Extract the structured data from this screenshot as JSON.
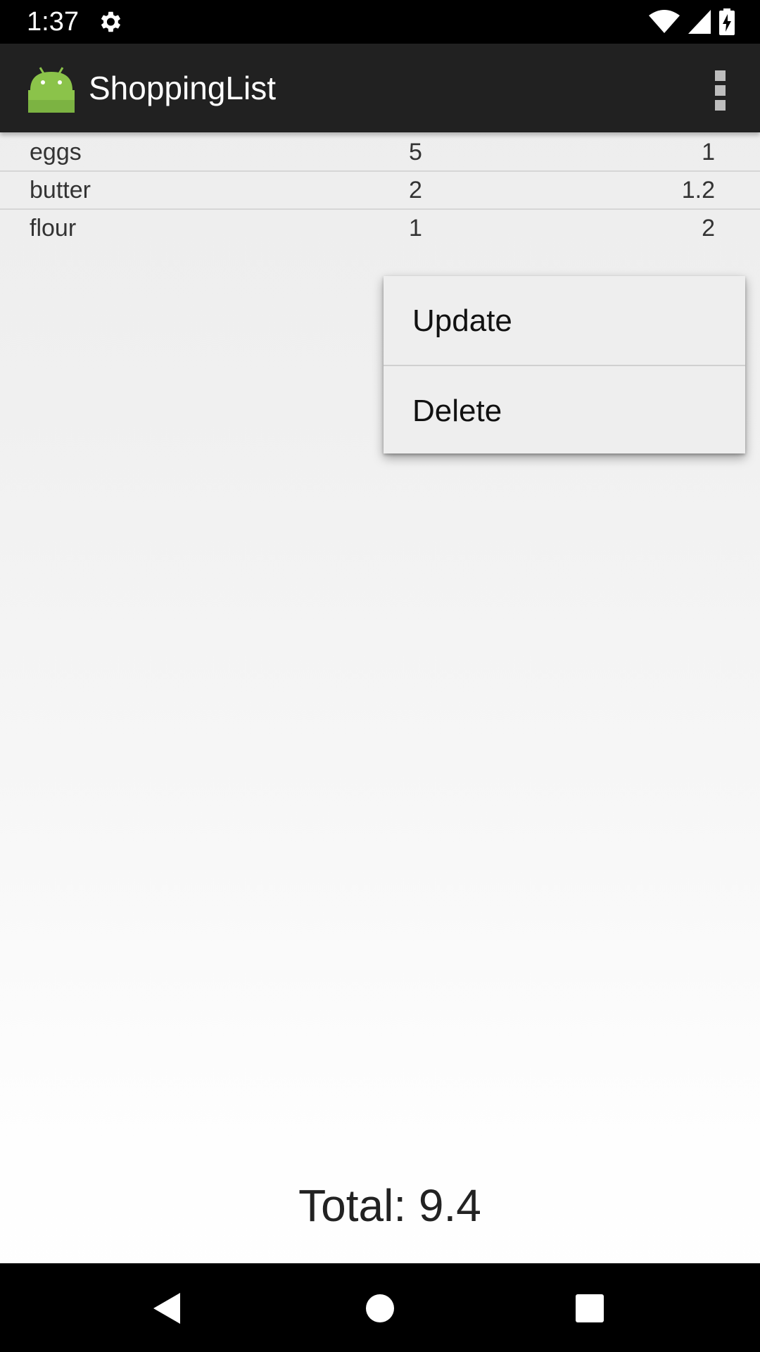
{
  "status_bar": {
    "time": "1:37",
    "icons": [
      "settings-gear-icon",
      "wifi-icon",
      "cell-signal-icon",
      "battery-charging-icon"
    ]
  },
  "action_bar": {
    "app_icon": "android-robot-icon",
    "title": "ShoppingList",
    "overflow_icon": "overflow-menu-icon"
  },
  "list": {
    "rows": [
      {
        "name": "eggs",
        "qty": "5",
        "price": "1"
      },
      {
        "name": "butter",
        "qty": "2",
        "price": "1.2"
      },
      {
        "name": "flour",
        "qty": "1",
        "price": "2"
      }
    ]
  },
  "context_menu": {
    "items": [
      {
        "label": "Update"
      },
      {
        "label": "Delete"
      }
    ]
  },
  "footer": {
    "total": "Total: 9.4"
  },
  "nav_bar": {
    "icons": [
      "back-icon",
      "home-icon",
      "recents-icon"
    ]
  },
  "colors": {
    "status_bar": "#000000",
    "action_bar": "#212121",
    "android_green": "#8bc34a",
    "menu_background": "#eeeeee"
  }
}
